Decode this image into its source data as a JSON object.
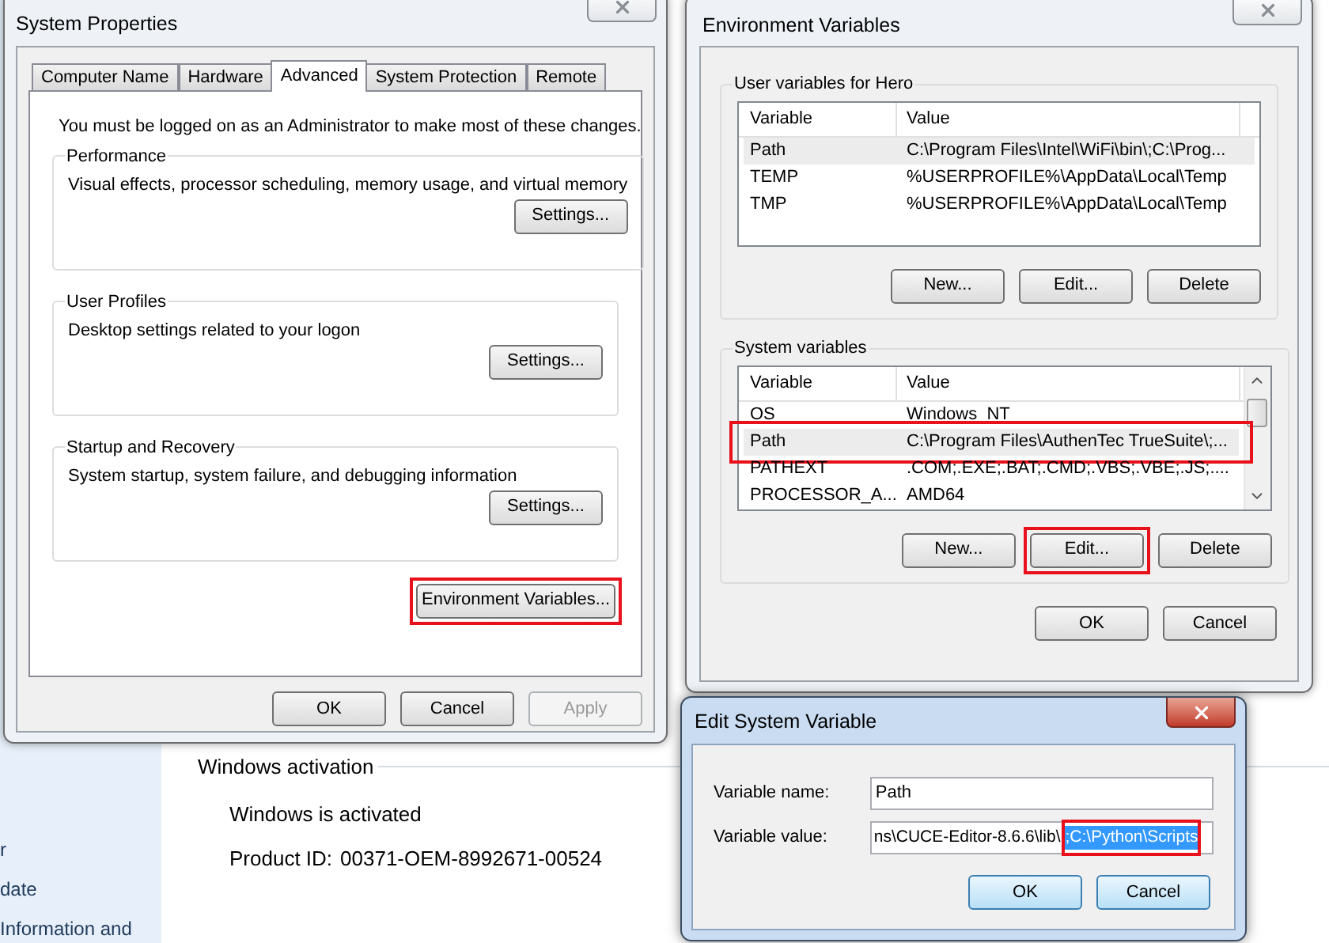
{
  "background": {
    "sidebar_items": [
      "r",
      "date",
      "Information and"
    ],
    "activation": {
      "heading": "Windows activation",
      "status": "Windows is activated",
      "product_id_label": "Product ID:",
      "product_id": "00371-OEM-8992671-00524"
    }
  },
  "system_properties": {
    "title": "System Properties",
    "tabs": [
      {
        "label": "Computer Name",
        "selected": false
      },
      {
        "label": "Hardware",
        "selected": false
      },
      {
        "label": "Advanced",
        "selected": true
      },
      {
        "label": "System Protection",
        "selected": false
      },
      {
        "label": "Remote",
        "selected": false
      }
    ],
    "notice": "You must be logged on as an Administrator to make most of these changes.",
    "groups": [
      {
        "title": "Performance",
        "description": "Visual effects, processor scheduling, memory usage, and virtual memory",
        "button": "Settings..."
      },
      {
        "title": "User Profiles",
        "description": "Desktop settings related to your logon",
        "button": "Settings..."
      },
      {
        "title": "Startup and Recovery",
        "description": "System startup, system failure, and debugging information",
        "button": "Settings..."
      }
    ],
    "env_button": {
      "label": "Environment Variables...",
      "highlighted": true
    },
    "buttons": [
      {
        "label": "OK",
        "disabled": false
      },
      {
        "label": "Cancel",
        "disabled": false
      },
      {
        "label": "Apply",
        "disabled": true
      }
    ]
  },
  "environment_variables": {
    "title": "Environment Variables",
    "groups": [
      {
        "title": "User variables for Hero",
        "columns": [
          "Variable",
          "Value"
        ],
        "scrollbar": false,
        "rows": [
          {
            "variable": "Path",
            "value": "C:\\Program Files\\Intel\\WiFi\\bin\\;C:\\Prog...",
            "selected": true,
            "highlighted": false
          },
          {
            "variable": "TEMP",
            "value": "%USERPROFILE%\\AppData\\Local\\Temp",
            "selected": false,
            "highlighted": false
          },
          {
            "variable": "TMP",
            "value": "%USERPROFILE%\\AppData\\Local\\Temp",
            "selected": false,
            "highlighted": false
          }
        ],
        "buttons": [
          {
            "label": "New...",
            "highlighted": false
          },
          {
            "label": "Edit...",
            "highlighted": false
          },
          {
            "label": "Delete",
            "highlighted": false
          }
        ]
      },
      {
        "title": "System variables",
        "columns": [
          "Variable",
          "Value"
        ],
        "scrollbar": true,
        "rows": [
          {
            "variable": "OS",
            "value": "Windows_NT",
            "selected": false,
            "highlighted": false
          },
          {
            "variable": "Path",
            "value": "C:\\Program Files\\AuthenTec TrueSuite\\;...",
            "selected": true,
            "highlighted": true
          },
          {
            "variable": "PATHEXT",
            "value": ".COM;.EXE;.BAT;.CMD;.VBS;.VBE;.JS;....",
            "selected": false,
            "highlighted": false
          },
          {
            "variable": "PROCESSOR_A...",
            "value": "AMD64",
            "selected": false,
            "highlighted": false
          }
        ],
        "buttons": [
          {
            "label": "New...",
            "highlighted": false
          },
          {
            "label": "Edit...",
            "highlighted": true
          },
          {
            "label": "Delete",
            "highlighted": false
          }
        ]
      }
    ],
    "buttons": [
      "OK",
      "Cancel"
    ]
  },
  "edit_variable": {
    "title": "Edit System Variable",
    "name_label": "Variable name:",
    "name_value": "Path",
    "value_label": "Variable value:",
    "value_parts": [
      {
        "text": "ns\\CUCE-Editor-8.6.6\\lib\\",
        "selected": false,
        "highlighted": false
      },
      {
        "text": ";C:\\Python\\Scripts",
        "selected": true,
        "highlighted": true
      }
    ],
    "buttons": [
      "OK",
      "Cancel"
    ]
  }
}
